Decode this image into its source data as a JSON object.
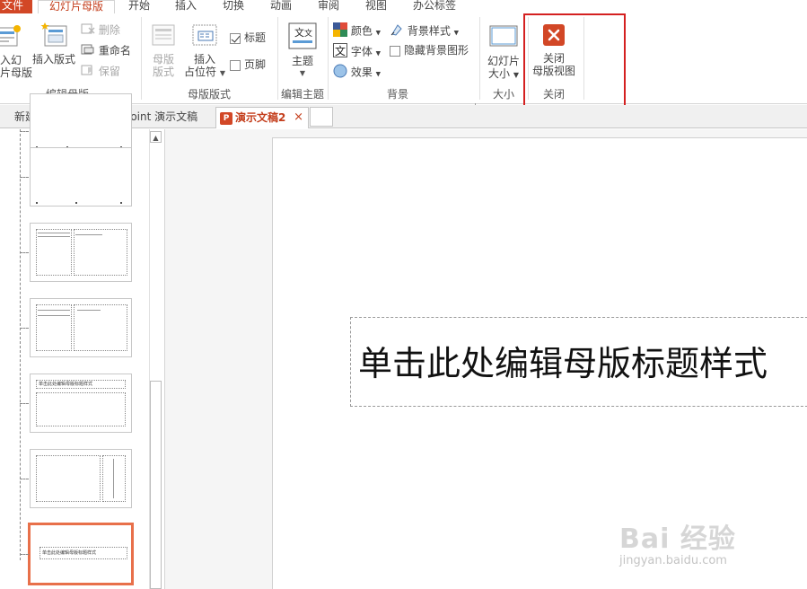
{
  "menubar": {
    "tabs": [
      "文件",
      "幻灯片母版",
      "开始",
      "插入",
      "切换",
      "动画",
      "审阅",
      "视图",
      "办公标签"
    ]
  },
  "ribbon": {
    "edit_master": {
      "insert_slide_master_l1": "入幻",
      "insert_slide_master_l2": "片母版",
      "insert_layout": "插入版式",
      "delete": "删除",
      "rename": "重命名",
      "preserve": "保留",
      "label": "编辑母版"
    },
    "master_layout": {
      "master_layout_l1": "母版",
      "master_layout_l2": "版式",
      "insert_placeholder_l1": "插入",
      "insert_placeholder_l2": "占位符",
      "title": "标题",
      "footer": "页脚",
      "label": "母版版式",
      "title_checked": true,
      "footer_checked": false
    },
    "edit_theme": {
      "themes": "主题",
      "label": "编辑主题"
    },
    "background": {
      "colors": "颜色",
      "fonts": "字体",
      "effects": "效果",
      "bg_styles": "背景样式",
      "hide_bg": "隐藏背景图形",
      "label": "背景"
    },
    "size": {
      "slide_size_l1": "幻灯片",
      "slide_size_l2": "大小",
      "label": "大小"
    },
    "close": {
      "close_view_l1": "关闭",
      "close_view_l2": "母版视图",
      "label": "关闭"
    }
  },
  "doctabs": {
    "doc1": "新建 Microsoft PowerPoint 演示文稿",
    "doc2": "演示文稿2",
    "close_glyph": "×"
  },
  "thumbnails": {
    "thumb_title": "单击此处编辑母版标题样式"
  },
  "slide": {
    "title_placeholder": "单击此处编辑母版标题样式"
  },
  "watermark": {
    "logo": "Bai 经验",
    "url": "jingyan.baidu.com"
  },
  "colors": {
    "accent": "#d24726",
    "accent_text": "#c43e1c",
    "highlight": "#d42020",
    "selected_thumb": "#e8704a"
  }
}
